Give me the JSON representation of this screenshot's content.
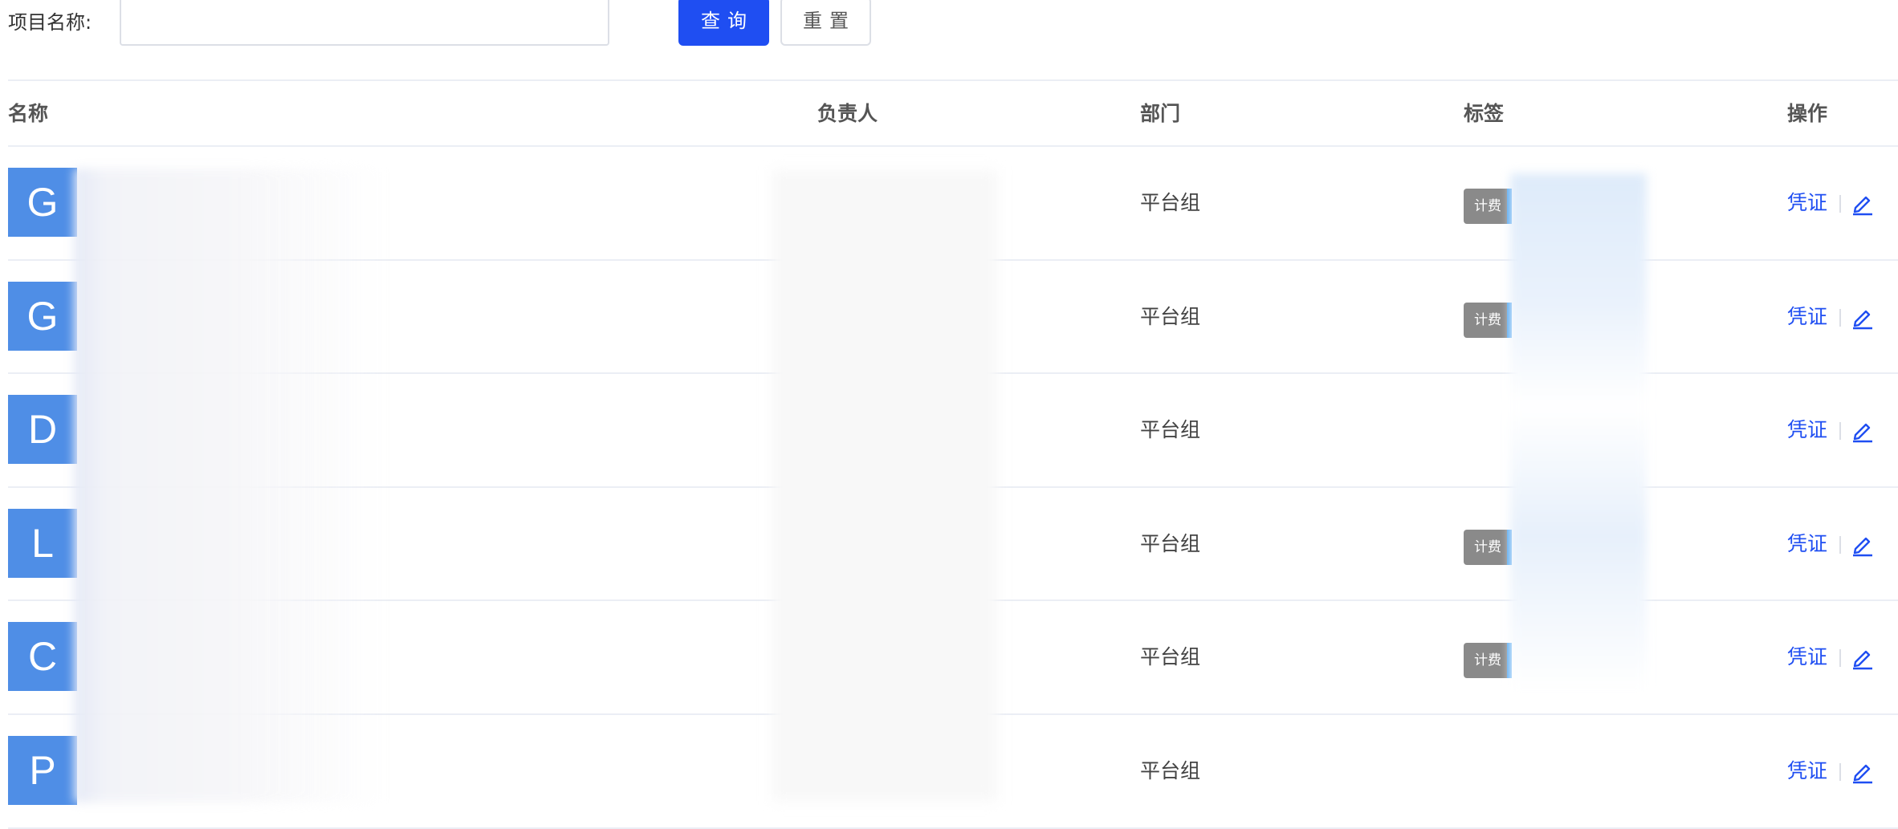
{
  "search": {
    "label": "项目名称:",
    "input_value": "",
    "input_placeholder": "",
    "query_button": "查询",
    "reset_button": "重置"
  },
  "table": {
    "headers": {
      "name": "名称",
      "owner": "负责人",
      "dept": "部门",
      "tags": "标签",
      "ops": "操作"
    },
    "rows": [
      {
        "avatar_letter": "G",
        "dept": "平台组",
        "tag": "计费",
        "op_link": "凭证",
        "edit_icon": "edit-icon"
      },
      {
        "avatar_letter": "G",
        "dept": "平台组",
        "tag": "计费",
        "op_link": "凭证",
        "edit_icon": "edit-icon"
      },
      {
        "avatar_letter": "D",
        "dept": "平台组",
        "tag": "",
        "op_link": "凭证",
        "edit_icon": "edit-icon"
      },
      {
        "avatar_letter": "L",
        "dept": "平台组",
        "tag": "计费",
        "op_link": "凭证",
        "edit_icon": "edit-icon"
      },
      {
        "avatar_letter": "C",
        "dept": "平台组",
        "tag": "计费",
        "op_link": "凭证",
        "edit_icon": "edit-icon"
      },
      {
        "avatar_letter": "P",
        "dept": "平台组",
        "tag": "",
        "op_link": "凭证",
        "edit_icon": "edit-icon"
      }
    ]
  },
  "colors": {
    "primary": "#1f4ef2",
    "avatar": "#4f8ee6",
    "tag_bg": "#8a8a8a",
    "tag_accent": "#4aa3f0",
    "border": "#ebeef5"
  }
}
